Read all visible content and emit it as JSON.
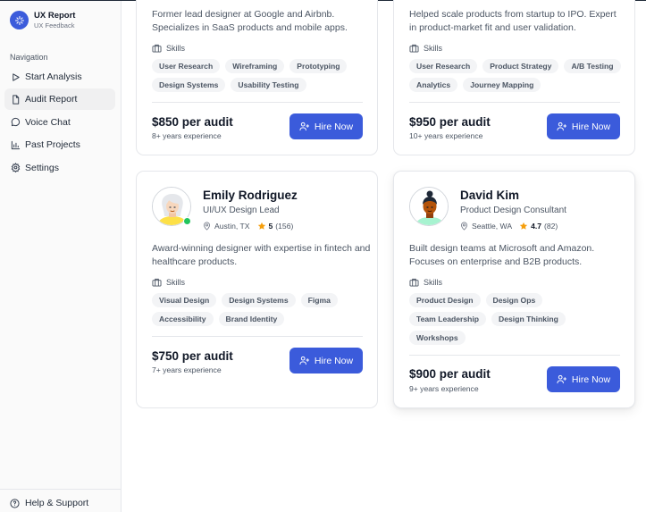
{
  "app": {
    "name": "UX Report",
    "subtitle": "UX Feedback"
  },
  "navigation": {
    "heading": "Navigation",
    "items": [
      {
        "label": "Start Analysis",
        "icon": "play-icon"
      },
      {
        "label": "Audit Report",
        "icon": "file-icon",
        "active": true
      },
      {
        "label": "Voice Chat",
        "icon": "chat-bubble-icon"
      },
      {
        "label": "Past Projects",
        "icon": "bar-chart-icon"
      },
      {
        "label": "Settings",
        "icon": "gear-icon"
      }
    ],
    "help": "Help & Support"
  },
  "colors": {
    "accent": "#3b5bdb",
    "online": "#22c55e",
    "star": "#f59e0b"
  },
  "designers": [
    {
      "bio": "Former lead designer at Google and Airbnb. Specializes in SaaS products and mobile apps.",
      "skills_label": "Skills",
      "skills": [
        "User Research",
        "Wireframing",
        "Prototyping",
        "Design Systems",
        "Usability Testing"
      ],
      "price": "$850 per audit",
      "experience": "8+ years experience",
      "cta": "Hire Now"
    },
    {
      "bio": "Helped scale products from startup to IPO. Expert in product-market fit and user validation.",
      "skills_label": "Skills",
      "skills": [
        "User Research",
        "Product Strategy",
        "A/B Testing",
        "Analytics",
        "Journey Mapping"
      ],
      "price": "$950 per audit",
      "experience": "10+ years experience",
      "cta": "Hire Now"
    },
    {
      "name": "Emily Rodriguez",
      "role": "UI/UX Design Lead",
      "location": "Austin, TX",
      "rating": "5",
      "reviews": "(156)",
      "online": true,
      "bio": "Award-winning designer with expertise in fintech and healthcare products.",
      "skills_label": "Skills",
      "skills": [
        "Visual Design",
        "Design Systems",
        "Figma",
        "Accessibility",
        "Brand Identity"
      ],
      "price": "$750 per audit",
      "experience": "7+ years experience",
      "cta": "Hire Now"
    },
    {
      "name": "David Kim",
      "role": "Product Design Consultant",
      "location": "Seattle, WA",
      "rating": "4.7",
      "reviews": "(82)",
      "online": false,
      "bio": "Built design teams at Microsoft and Amazon. Focuses on enterprise and B2B products.",
      "skills_label": "Skills",
      "skills": [
        "Product Design",
        "Design Ops",
        "Team Leadership",
        "Design Thinking",
        "Workshops"
      ],
      "price": "$900 per audit",
      "experience": "9+ years experience",
      "cta": "Hire Now"
    }
  ]
}
